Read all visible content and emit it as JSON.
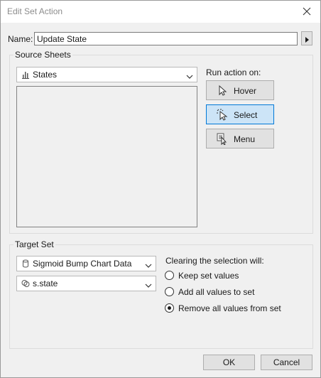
{
  "window": {
    "title": "Edit Set Action"
  },
  "name_field": {
    "label": "Name:",
    "value": "Update State"
  },
  "source": {
    "group_label": "Source Sheets",
    "sheet_select": "States",
    "run_action_label": "Run action on:",
    "actions": [
      {
        "label": "Hover",
        "selected": false
      },
      {
        "label": "Select",
        "selected": true
      },
      {
        "label": "Menu",
        "selected": false
      }
    ]
  },
  "target": {
    "group_label": "Target Set",
    "datasource_select": "Sigmoid Bump Chart Data",
    "set_select": "s.state",
    "clearing_label": "Clearing the selection will:",
    "options": [
      {
        "label": "Keep set values",
        "checked": false
      },
      {
        "label": "Add all values to set",
        "checked": false
      },
      {
        "label": "Remove all values from set",
        "checked": true
      }
    ]
  },
  "footer": {
    "ok_label": "OK",
    "cancel_label": "Cancel"
  },
  "colors": {
    "selected_bg": "#cce4f7",
    "selected_border": "#0078d7"
  }
}
